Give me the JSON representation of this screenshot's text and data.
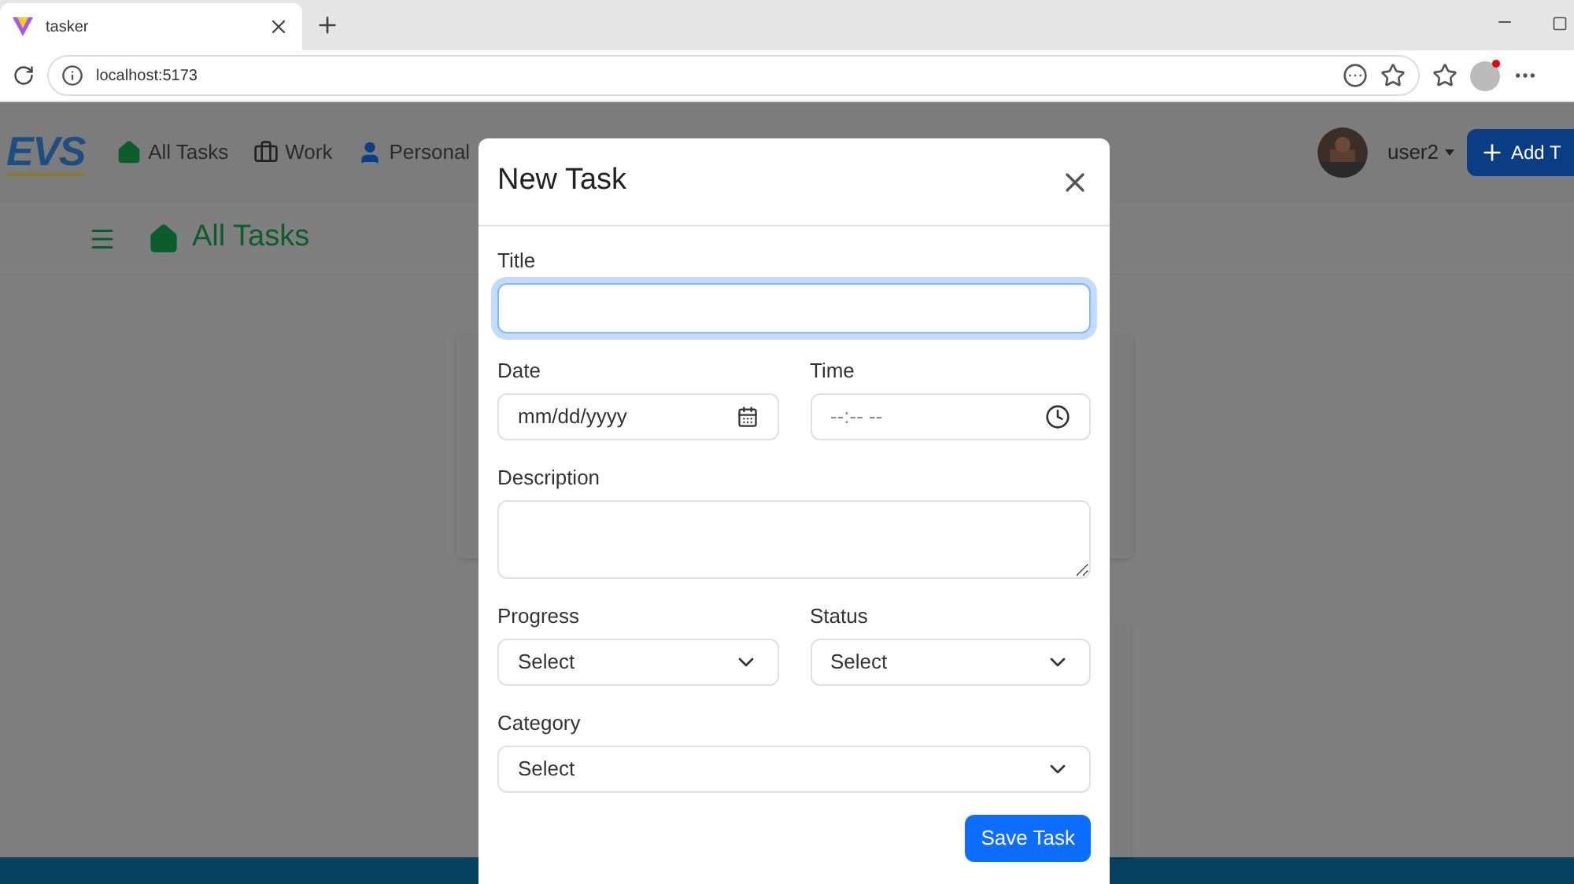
{
  "browser": {
    "tab_title": "tasker",
    "address": "localhost:5173"
  },
  "navbar": {
    "logo": "EVS",
    "items": [
      {
        "label": "All Tasks",
        "kind": "home"
      },
      {
        "label": "Work",
        "kind": "work"
      },
      {
        "label": "Personal",
        "kind": "personal"
      }
    ],
    "user": "user2",
    "add_button": "Add T"
  },
  "header": {
    "title": "All Tasks"
  },
  "modal": {
    "title": "New Task",
    "rows": [
      [
        {
          "kind": "text",
          "label": "Title",
          "focused": true
        }
      ],
      [
        {
          "kind": "date",
          "label": "Date",
          "placeholder": "mm/dd/yyyy",
          "focused": false
        },
        {
          "kind": "time",
          "label": "Time",
          "placeholder": "--:-- --",
          "focused": false
        }
      ],
      [
        {
          "kind": "textarea",
          "label": "Description",
          "focused": false
        }
      ],
      [
        {
          "kind": "select",
          "label": "Progress",
          "value": "Select",
          "focused": false
        },
        {
          "kind": "select",
          "label": "Status",
          "value": "Select",
          "focused": false
        }
      ],
      [
        {
          "kind": "select",
          "label": "Category",
          "value": "Select",
          "focused": false
        }
      ]
    ],
    "save_button": "Save Task"
  }
}
